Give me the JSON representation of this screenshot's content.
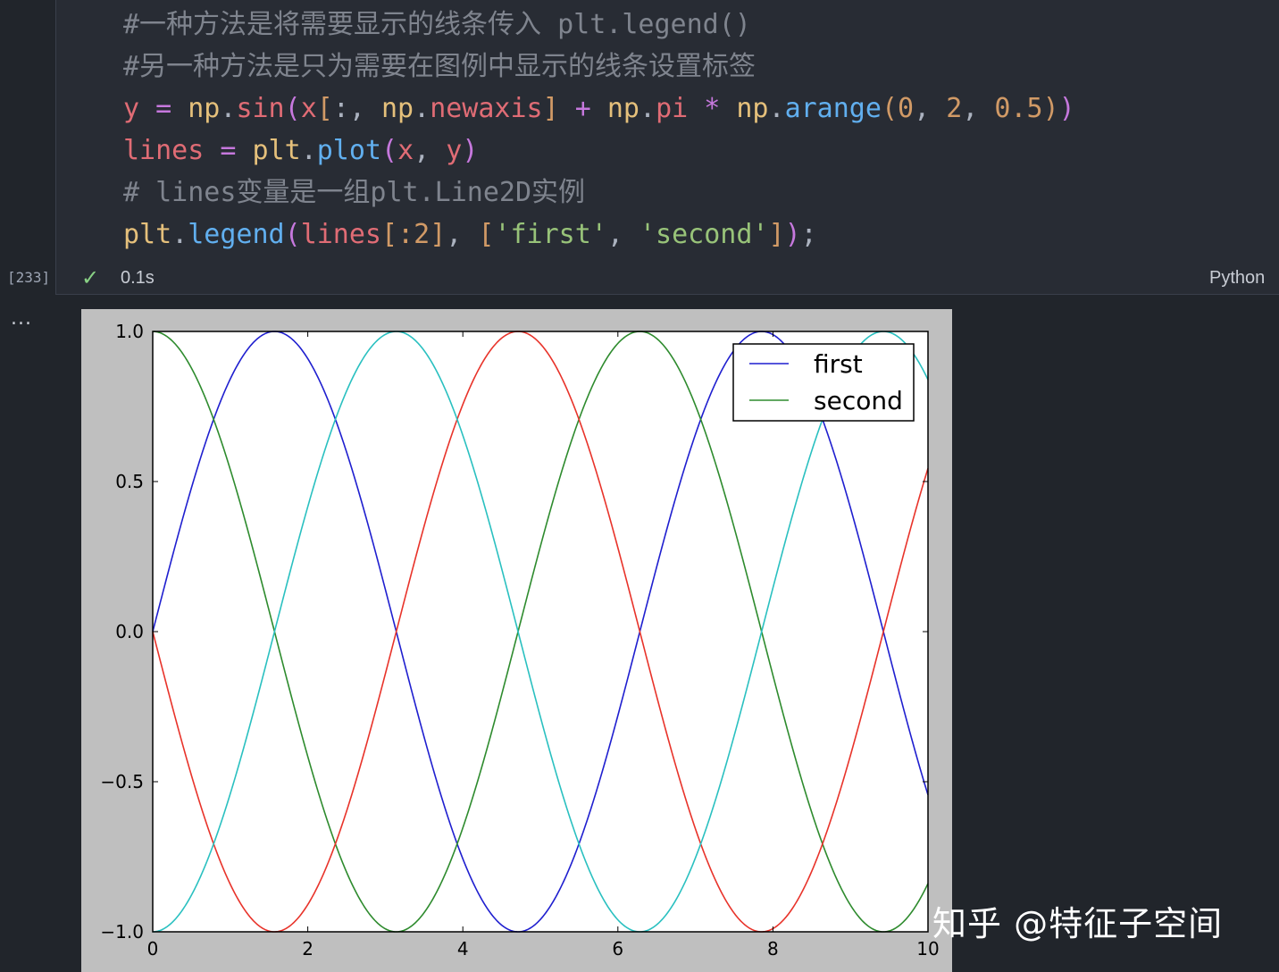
{
  "cell": {
    "code_lines": [
      [
        {
          "t": "#一种方法是将需要显示的线条传入 plt.legend()",
          "c": "cm"
        }
      ],
      [
        {
          "t": "#另一种方法是只为需要在图例中显示的线条设置标签",
          "c": "cm"
        }
      ],
      [
        {
          "t": "y",
          "c": "var"
        },
        {
          "t": " = ",
          "c": "op"
        },
        {
          "t": "np",
          "c": "mod"
        },
        {
          "t": ".",
          "c": "pl"
        },
        {
          "t": "sin",
          "c": "var"
        },
        {
          "t": "(",
          "c": "br1"
        },
        {
          "t": "x",
          "c": "var"
        },
        {
          "t": "[",
          "c": "br2"
        },
        {
          "t": ":, ",
          "c": "pl"
        },
        {
          "t": "np",
          "c": "mod"
        },
        {
          "t": ".",
          "c": "pl"
        },
        {
          "t": "newaxis",
          "c": "var"
        },
        {
          "t": "]",
          "c": "br2"
        },
        {
          "t": " + ",
          "c": "op"
        },
        {
          "t": "np",
          "c": "mod"
        },
        {
          "t": ".",
          "c": "pl"
        },
        {
          "t": "pi",
          "c": "var"
        },
        {
          "t": " * ",
          "c": "op"
        },
        {
          "t": "np",
          "c": "mod"
        },
        {
          "t": ".",
          "c": "pl"
        },
        {
          "t": "arange",
          "c": "fn"
        },
        {
          "t": "(",
          "c": "br2"
        },
        {
          "t": "0",
          "c": "num"
        },
        {
          "t": ", ",
          "c": "pl"
        },
        {
          "t": "2",
          "c": "num"
        },
        {
          "t": ", ",
          "c": "pl"
        },
        {
          "t": "0.5",
          "c": "num"
        },
        {
          "t": ")",
          "c": "br2"
        },
        {
          "t": ")",
          "c": "br1"
        }
      ],
      [
        {
          "t": "lines",
          "c": "var"
        },
        {
          "t": " = ",
          "c": "op"
        },
        {
          "t": "plt",
          "c": "mod"
        },
        {
          "t": ".",
          "c": "pl"
        },
        {
          "t": "plot",
          "c": "fn"
        },
        {
          "t": "(",
          "c": "br1"
        },
        {
          "t": "x",
          "c": "var"
        },
        {
          "t": ", ",
          "c": "pl"
        },
        {
          "t": "y",
          "c": "var"
        },
        {
          "t": ")",
          "c": "br1"
        }
      ],
      [
        {
          "t": "# lines变量是一组plt.Line2D实例",
          "c": "cm"
        }
      ],
      [
        {
          "t": "plt",
          "c": "mod"
        },
        {
          "t": ".",
          "c": "pl"
        },
        {
          "t": "legend",
          "c": "fn"
        },
        {
          "t": "(",
          "c": "br1"
        },
        {
          "t": "lines",
          "c": "var"
        },
        {
          "t": "[",
          "c": "br2"
        },
        {
          "t": ":2",
          "c": "num"
        },
        {
          "t": "]",
          "c": "br2"
        },
        {
          "t": ", ",
          "c": "pl"
        },
        {
          "t": "[",
          "c": "br2"
        },
        {
          "t": "'first'",
          "c": "str"
        },
        {
          "t": ", ",
          "c": "pl"
        },
        {
          "t": "'second'",
          "c": "str"
        },
        {
          "t": "]",
          "c": "br2"
        },
        {
          "t": ")",
          "c": "br1"
        },
        {
          "t": ";",
          "c": "pl"
        }
      ]
    ],
    "execution_count": "[233]",
    "status_icon": "check-icon",
    "duration": "0.1s",
    "language": "Python",
    "output_menu": "..."
  },
  "chart_data": {
    "type": "line",
    "function": "y = sin(x + pi * k), k in [0, 0.5, 1.0, 1.5]",
    "xlim": [
      0,
      10
    ],
    "ylim": [
      -1.0,
      1.0
    ],
    "x_ticks": [
      "0",
      "2",
      "4",
      "6",
      "8",
      "10"
    ],
    "y_ticks": [
      "1.0",
      "0.5",
      "0.0",
      "−0.5",
      "−1.0"
    ],
    "series": [
      {
        "name": "first",
        "phase": 0.0,
        "color": "#1f1fcf"
      },
      {
        "name": "second",
        "phase": 0.5,
        "color": "#2e8b2e"
      },
      {
        "phase": 1.0,
        "color": "#e8332a"
      },
      {
        "phase": 1.5,
        "color": "#2ac0c0"
      }
    ],
    "legend": {
      "entries": [
        "first",
        "second"
      ],
      "position": "upper right"
    },
    "grid": false
  },
  "watermark": "知乎 @特征子空间"
}
